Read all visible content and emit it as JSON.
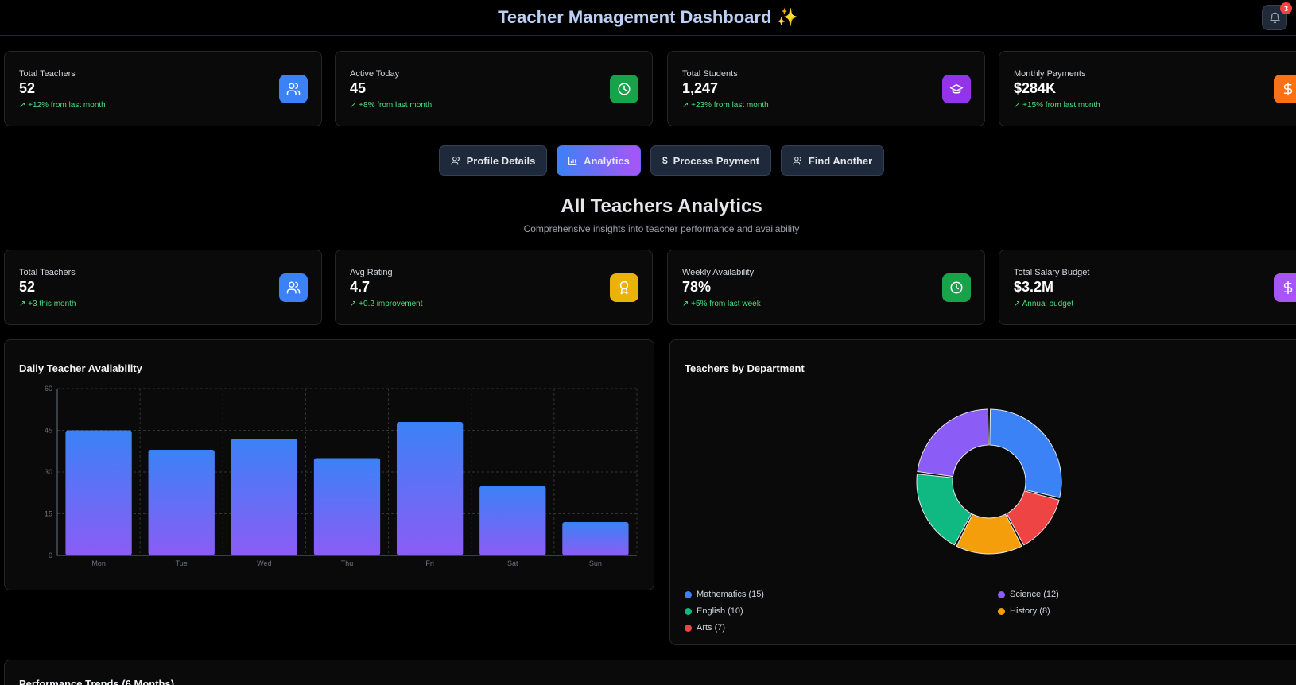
{
  "header": {
    "title": "Teacher Management Dashboard ✨",
    "notification_count": "3"
  },
  "top_stats": [
    {
      "label": "Total Teachers",
      "value": "52",
      "change": "+12% from last month",
      "icon": "users-icon",
      "color": "#3b82f6"
    },
    {
      "label": "Active Today",
      "value": "45",
      "change": "+8% from last month",
      "icon": "clock-icon",
      "color": "#16a34a"
    },
    {
      "label": "Total Students",
      "value": "1,247",
      "change": "+23% from last month",
      "icon": "graduation-cap-icon",
      "color": "#9333ea"
    },
    {
      "label": "Monthly Payments",
      "value": "$284K",
      "change": "+15% from last month",
      "icon": "dollar-icon",
      "color": "#f97316"
    }
  ],
  "tabs": [
    {
      "label": "Profile Details",
      "icon": "user-icon",
      "active": false
    },
    {
      "label": "Analytics",
      "icon": "bar-chart-icon",
      "active": true
    },
    {
      "label": "Process Payment",
      "icon": "dollar-icon",
      "active": false
    },
    {
      "label": "Find Another",
      "icon": "users-icon",
      "active": false
    }
  ],
  "analytics": {
    "title": "All Teachers Analytics",
    "subtitle": "Comprehensive insights into teacher performance and availability"
  },
  "analytics_stats": [
    {
      "label": "Total Teachers",
      "value": "52",
      "change": "+3 this month",
      "icon": "users-icon",
      "color": "#3b82f6"
    },
    {
      "label": "Avg Rating",
      "value": "4.7",
      "change": "+0.2 improvement",
      "icon": "award-icon",
      "color": "#eab308"
    },
    {
      "label": "Weekly Availability",
      "value": "78%",
      "change": "+5% from last week",
      "icon": "clock-icon",
      "color": "#16a34a"
    },
    {
      "label": "Total Salary Budget",
      "value": "$3.2M",
      "change": "Annual budget",
      "icon": "dollar-icon",
      "color": "#a855f7"
    }
  ],
  "availability_panel": {
    "title": "Daily Teacher Availability"
  },
  "department_panel": {
    "title": "Teachers by Department"
  },
  "performance_panel": {
    "title": "Performance Trends (6 Months)"
  },
  "chart_data": [
    {
      "type": "bar",
      "title": "Daily Teacher Availability",
      "categories": [
        "Mon",
        "Tue",
        "Wed",
        "Thu",
        "Fri",
        "Sat",
        "Sun"
      ],
      "values": [
        45,
        38,
        42,
        35,
        48,
        25,
        12
      ],
      "yticks": [
        0,
        15,
        30,
        45,
        60
      ],
      "ylim": [
        0,
        60
      ],
      "grid": true,
      "colors": [
        "#3b82f6",
        "#8b5cf6"
      ]
    },
    {
      "type": "pie",
      "title": "Teachers by Department",
      "donut": true,
      "slices": [
        {
          "label": "Mathematics",
          "value": 15,
          "color": "#3b82f6"
        },
        {
          "label": "Arts",
          "value": 7,
          "color": "#ef4444"
        },
        {
          "label": "History",
          "value": 8,
          "color": "#f59e0b"
        },
        {
          "label": "English",
          "value": 10,
          "color": "#10b981"
        },
        {
          "label": "Science",
          "value": 12,
          "color": "#8b5cf6"
        }
      ],
      "legend": [
        {
          "text": "Mathematics (15)",
          "color": "#3b82f6"
        },
        {
          "text": "Science (12)",
          "color": "#8b5cf6"
        },
        {
          "text": "English (10)",
          "color": "#10b981"
        },
        {
          "text": "History (8)",
          "color": "#f59e0b"
        },
        {
          "text": "Arts (7)",
          "color": "#ef4444"
        }
      ],
      "legend_position": "bottom"
    }
  ]
}
